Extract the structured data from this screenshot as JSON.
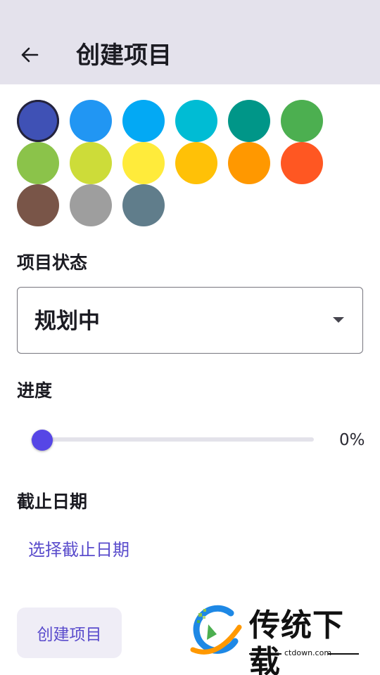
{
  "header": {
    "title": "创建项目",
    "back_icon": "arrow-left-icon"
  },
  "colors": {
    "selected_index": 0,
    "swatches": [
      "#3f51b5",
      "#2196f3",
      "#03a9f4",
      "#00bcd4",
      "#009688",
      "#4caf50",
      "#8bc34a",
      "#cddc39",
      "#ffeb3b",
      "#ffc107",
      "#ff9800",
      "#ff5722",
      "#795548",
      "#9e9e9e",
      "#607d8b"
    ]
  },
  "status": {
    "label": "项目状态",
    "value": "规划中"
  },
  "progress": {
    "label": "进度",
    "value": 0,
    "value_text": "0%",
    "accent": "#5646e6"
  },
  "deadline": {
    "label": "截止日期",
    "link_text": "选择截止日期"
  },
  "submit": {
    "label": "创建项目"
  },
  "watermark": {
    "brand": "传统下载",
    "url": "ctdown.com"
  }
}
